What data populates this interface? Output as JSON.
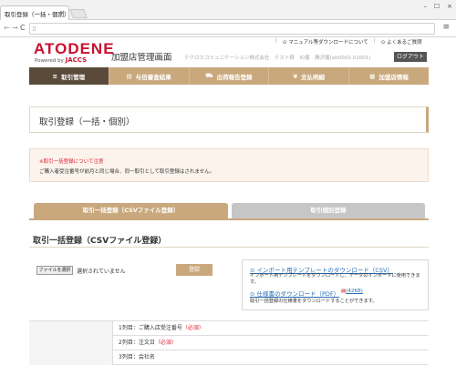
{
  "browser": {
    "tab_title": "取引登録（一括・個別）",
    "tab_close": "×",
    "window_controls": [
      "–",
      "☐",
      "×"
    ],
    "nav_back": "←",
    "nav_forward": "→",
    "nav_reload": "C",
    "menu_glyph": "≡"
  },
  "header": {
    "logo": "ATODENE",
    "powered_label": "Powered by",
    "powered_brand": "JACCS",
    "title": "加盟店管理画面",
    "user_info": "テクロスコミュニケーション株式会社　テスト様　ID番　勝沢番(ab0001-01001)",
    "links": [
      "マニュアル等ダウンロードについて",
      "よくあるご質問"
    ],
    "logout": "ログアウト"
  },
  "nav": {
    "items": [
      {
        "label": "取引管理",
        "icon": "≡"
      },
      {
        "label": "与信審査結果",
        "icon": "▤"
      },
      {
        "label": "出荷報告登録",
        "icon": "⛟"
      },
      {
        "label": "支払明細",
        "icon": "¥"
      },
      {
        "label": "加盟店情報",
        "icon": "▦"
      }
    ]
  },
  "page": {
    "title": "取引登録（一括・個別）",
    "notice_title": "※取引一括登録について注意",
    "notice_body": "ご購入者受注番号が前月と同じ場合、同一取引として取引登録はされません。",
    "tab_csv": "取引一括登録（CSVファイル登録）",
    "tab_single": "取引個別登録",
    "section_title": "取引一括登録（CSVファイル登録）",
    "file_button": "ファイルを選択",
    "file_status": "選択されていません",
    "register_button": "登録",
    "info": {
      "link1": "インポート用テンプレートのダウンロード（CSV）",
      "desc1": "インポート用テンプレートをダウンロードし、データのインポートに使用できます。",
      "link2": "仕様書のダウンロード（PDF）",
      "pdf_label": "(42KB)",
      "desc2": "取引一括登録の仕様書をダウンロードすることができます。"
    },
    "rows": [
      {
        "label": "1列目：ご購入店受注番号",
        "required": "（必須）"
      },
      {
        "label": "2列目：注文日",
        "required": "（必須）"
      },
      {
        "label": "3列目：会社名",
        "required": ""
      }
    ]
  }
}
